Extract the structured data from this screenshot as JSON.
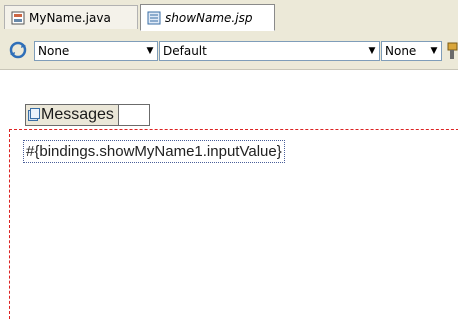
{
  "tabs": [
    {
      "label": "MyName.java",
      "icon": "java-file-icon",
      "active": false
    },
    {
      "label": "showName.jsp",
      "icon": "jsp-file-icon",
      "active": true
    }
  ],
  "toolbar": {
    "style_class_value": "None",
    "style_value": "Default",
    "font_value": "None"
  },
  "canvas": {
    "messages_label": "Messages",
    "expression": "#{bindings.showMyName1.inputValue}"
  },
  "colors": {
    "chrome": "#ece9d8",
    "form_border": "#dd2222",
    "field_border": "#4a5f9a"
  }
}
